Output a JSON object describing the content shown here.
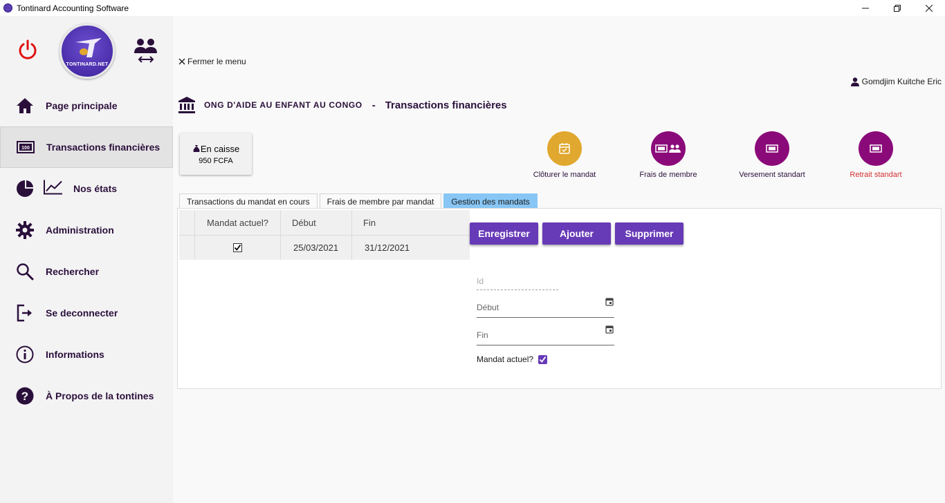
{
  "window": {
    "title": "Tontinard Accounting Software",
    "controls": [
      "minimize",
      "maximize",
      "close"
    ]
  },
  "sidebar": {
    "logo_text": "TONTINARD.NET",
    "items": [
      {
        "label": "Page principale",
        "icon": "home-icon",
        "active": false
      },
      {
        "label": "Transactions financières",
        "icon": "banknote-icon",
        "active": true
      },
      {
        "label": "Nos états",
        "icon": "pie-chart-icon",
        "active": false
      },
      {
        "label": "Administration",
        "icon": "gear-icon",
        "active": false
      },
      {
        "label": "Rechercher",
        "icon": "search-icon",
        "active": false
      },
      {
        "label": "Se deconnecter",
        "icon": "logout-icon",
        "active": false
      },
      {
        "label": "Informations",
        "icon": "info-icon",
        "active": false
      },
      {
        "label": "À Propos de la  tontines",
        "icon": "help-icon",
        "active": false
      }
    ]
  },
  "header": {
    "close_menu": "Fermer le menu",
    "user_name": "Gomdjim Kuitche Eric",
    "org_name": "ONG D'AIDE AU ENFANT AU CONGO",
    "separator": "-",
    "page_title": "Transactions financières"
  },
  "cash": {
    "title": "En caisse",
    "amount": "950 FCFA"
  },
  "actions": [
    {
      "label": "Clôturer le mandat",
      "icon": "calendar-check-icon",
      "color": "#e0a82e",
      "label_color": "#2a0f3b"
    },
    {
      "label": "Frais de membre",
      "icon": "banknote-people-icon",
      "color": "#8b0a7a",
      "label_color": "#2a0f3b"
    },
    {
      "label": "Versement standart",
      "icon": "banknote-icon",
      "color": "#8b0a7a",
      "label_color": "#2a0f3b"
    },
    {
      "label": "Retrait standart",
      "icon": "banknote-icon",
      "color": "#8b0a7a",
      "label_color": "#d32f2f"
    }
  ],
  "tabs": [
    {
      "label": "Transactions du mandat en cours",
      "active": false
    },
    {
      "label": "Frais de membre par mandat",
      "active": false
    },
    {
      "label": "Gestion des mandats",
      "active": true
    }
  ],
  "grid": {
    "columns": [
      "Mandat actuel?",
      "Début",
      "Fin"
    ],
    "rows": [
      {
        "mandat_actuel": true,
        "debut": "25/03/2021",
        "fin": "31/12/2021"
      }
    ]
  },
  "buttons": {
    "save": "Enregistrer",
    "add": "Ajouter",
    "delete": "Supprimer"
  },
  "form": {
    "id_placeholder": "Id",
    "debut_placeholder": "Début",
    "fin_placeholder": "Fin",
    "mandat_label": "Mandat actuel?",
    "mandat_checked": true
  },
  "colors": {
    "accent": "#673ab7",
    "primary_text": "#2a0f3b",
    "power": "#e01010",
    "tab_active": "#87c6f5"
  }
}
